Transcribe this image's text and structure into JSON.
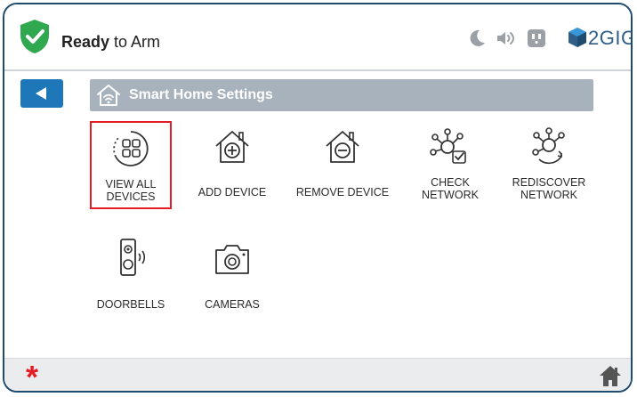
{
  "header": {
    "status_strong": "Ready",
    "status_rest": " to Arm",
    "brand_text": "2GIG",
    "icons": [
      "shield-check-icon",
      "moon-icon",
      "speaker-icon",
      "outlet-icon"
    ]
  },
  "titlebar": {
    "title": "Smart Home Settings",
    "icon": "home-wifi-icon"
  },
  "tiles": [
    {
      "label_line1": "VIEW ALL",
      "label_line2": "DEVICES",
      "icon": "view-all-devices-icon",
      "selected": true
    },
    {
      "label_line1": "ADD DEVICE",
      "label_line2": "",
      "icon": "add-device-icon"
    },
    {
      "label_line1": "REMOVE DEVICE",
      "label_line2": "",
      "icon": "remove-device-icon"
    },
    {
      "label_line1": "CHECK",
      "label_line2": "NETWORK",
      "icon": "check-network-icon"
    },
    {
      "label_line1": "REDISCOVER",
      "label_line2": "NETWORK",
      "icon": "rediscover-network-icon"
    },
    {
      "label_line1": "DOORBELLS",
      "label_line2": "",
      "icon": "doorbell-icon"
    },
    {
      "label_line1": "CAMERAS",
      "label_line2": "",
      "icon": "camera-icon"
    }
  ],
  "footer": {
    "asterisk": "*",
    "home_icon": "home-icon"
  },
  "colors": {
    "accent_blue": "#1e77b8",
    "titlebar_gray": "#a7b2bd",
    "ready_green": "#2fa84f",
    "alert_red": "#e31d24",
    "brand_blue": "#2f5e89"
  }
}
